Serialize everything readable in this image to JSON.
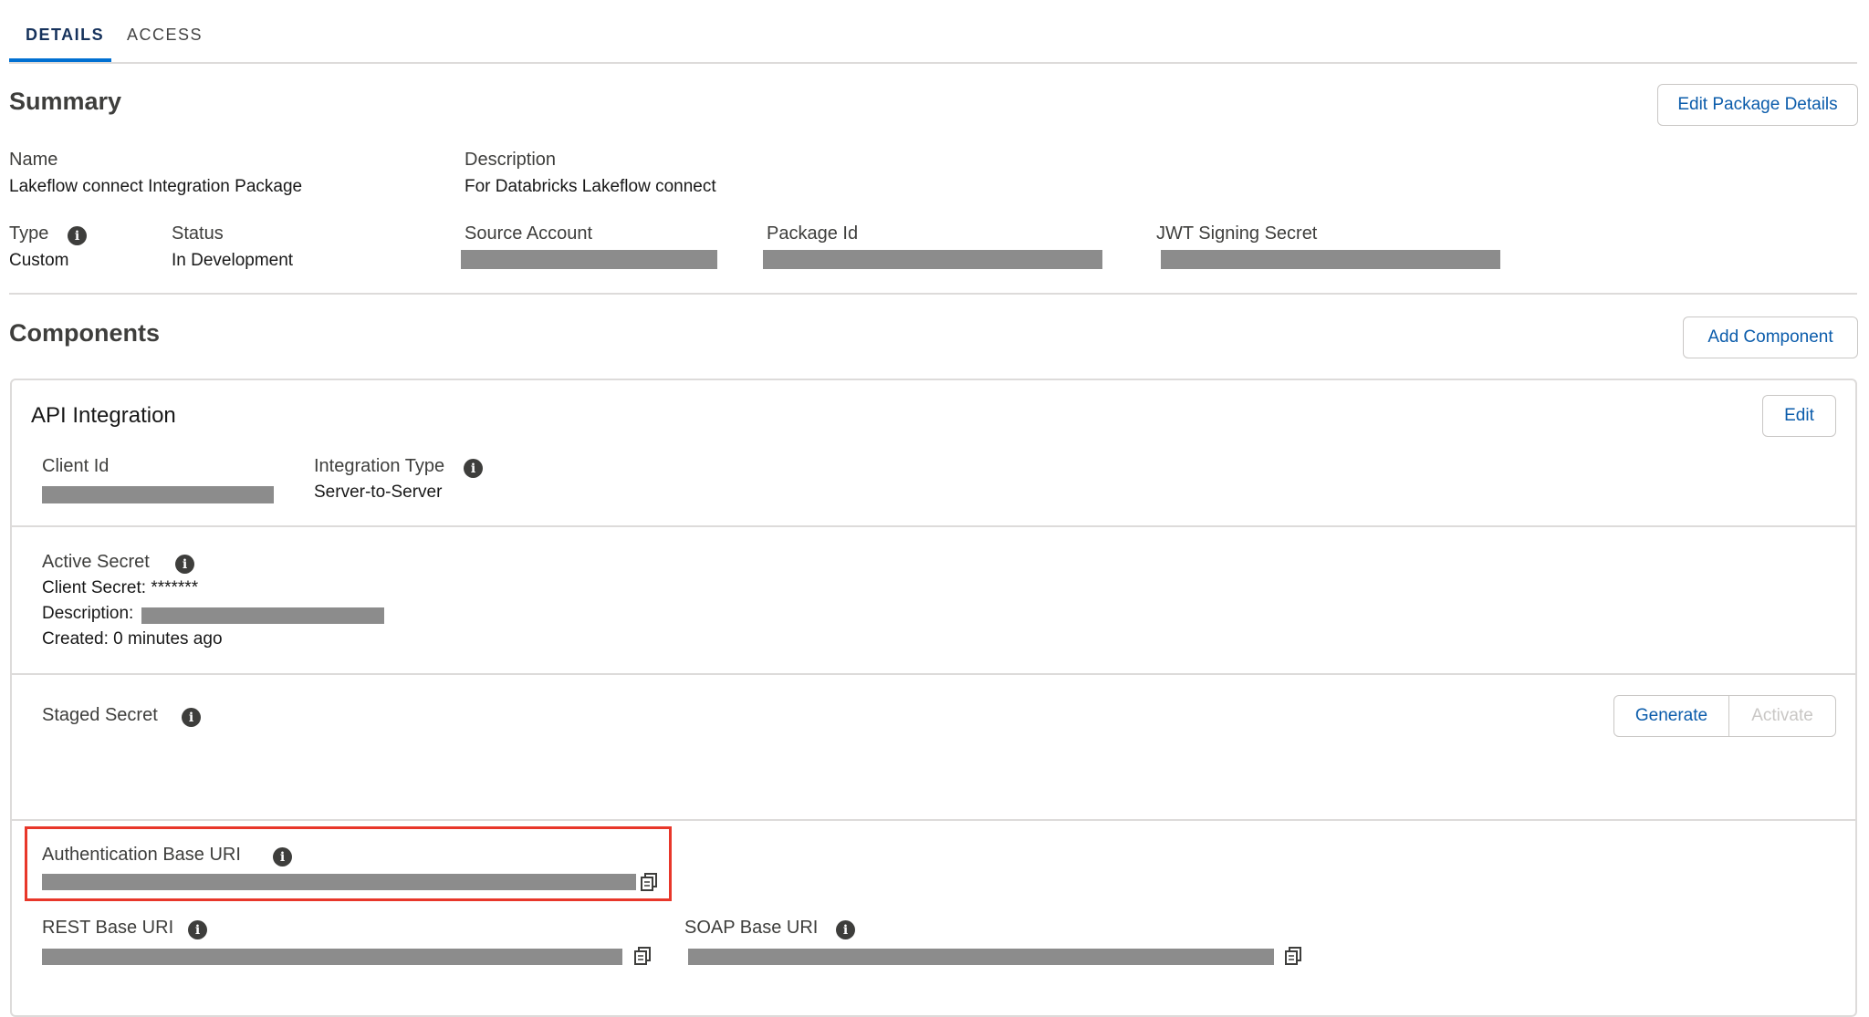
{
  "tabs": [
    "DETAILS",
    "ACCESS"
  ],
  "summary": {
    "title": "Summary",
    "edit_button": "Edit Package Details",
    "name_label": "Name",
    "name_value": "Lakeflow connect Integration Package",
    "description_label": "Description",
    "description_value": "For Databricks Lakeflow connect",
    "type_label": "Type",
    "type_value": "Custom",
    "status_label": "Status",
    "status_value": "In Development",
    "source_account_label": "Source Account",
    "package_id_label": "Package Id",
    "jwt_label": "JWT Signing Secret"
  },
  "components": {
    "title": "Components",
    "add_button": "Add Component"
  },
  "api_integration": {
    "title": "API Integration",
    "edit_button": "Edit",
    "client_id_label": "Client Id",
    "integration_type_label": "Integration Type",
    "integration_type_value": "Server-to-Server",
    "active_secret_label": "Active Secret",
    "client_secret_line": "Client Secret: *******",
    "description_prefix": "Description:",
    "created_line": "Created: 0 minutes ago",
    "staged_secret_label": "Staged Secret",
    "generate_button": "Generate",
    "activate_button": "Activate",
    "auth_base_uri_label": "Authentication Base URI",
    "rest_base_uri_label": "REST Base URI",
    "soap_base_uri_label": "SOAP Base URI"
  },
  "icons": {
    "info": "info-icon",
    "copy": "copy-icon"
  },
  "colors": {
    "accent": "#0070d2",
    "button_text": "#0b5cab",
    "highlight": "#e8372a",
    "redaction": "#8c8c8c"
  }
}
